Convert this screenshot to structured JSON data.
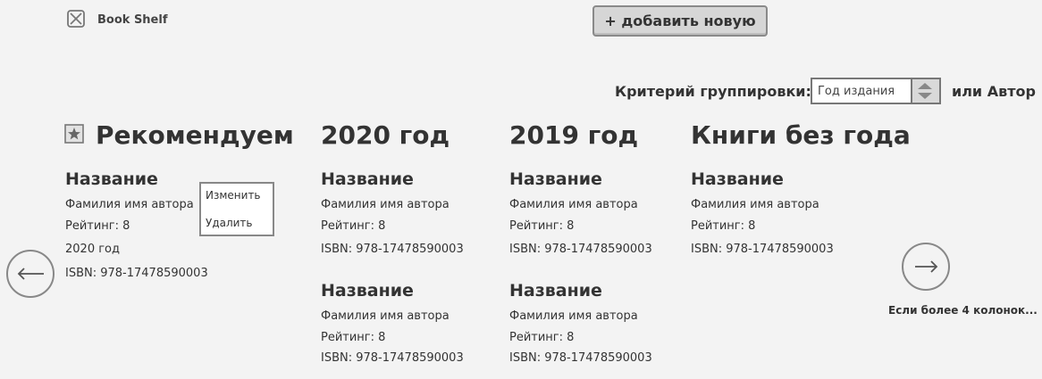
{
  "header": {
    "app_name": "Book Shelf",
    "logo_icon": "crossed-box-icon",
    "add_button_label": "+ добавить новую"
  },
  "grouping": {
    "label": "Критерий группировки:",
    "selected": "Год издания",
    "or_author": "или Автор"
  },
  "columns": [
    {
      "title": "Рекомендуем",
      "icon": "star-icon",
      "books": [
        {
          "title": "Название",
          "author": "Фамилия имя автора",
          "rating": "Рейтинг: 8",
          "year": "2020 год",
          "isbn": "ISBN: 978-17478590003"
        }
      ]
    },
    {
      "title": "2020 год",
      "books": [
        {
          "title": "Название",
          "author": "Фамилия имя автора",
          "rating": "Рейтинг: 8",
          "isbn": "ISBN: 978-17478590003"
        },
        {
          "title": "Название",
          "author": "Фамилия имя автора",
          "rating": "Рейтинг: 8",
          "isbn": "ISBN: 978-17478590003"
        }
      ]
    },
    {
      "title": "2019 год",
      "books": [
        {
          "title": "Название",
          "author": "Фамилия имя автора",
          "rating": "Рейтинг: 8",
          "isbn": "ISBN: 978-17478590003"
        },
        {
          "title": "Название",
          "author": "Фамилия имя автора",
          "rating": "Рейтинг: 8",
          "isbn": "ISBN: 978-17478590003"
        }
      ]
    },
    {
      "title": "Книги без года",
      "books": [
        {
          "title": "Название",
          "author": "Фамилия имя автора",
          "rating": "Рейтинг: 8",
          "isbn": "ISBN: 978-17478590003"
        }
      ]
    }
  ],
  "context_menu": {
    "edit": "Изменить",
    "delete": "Удалить"
  },
  "navigation": {
    "prev_icon": "arrow-left-icon",
    "next_icon": "arrow-right-icon",
    "more_note": "Если более 4 колонок..."
  }
}
